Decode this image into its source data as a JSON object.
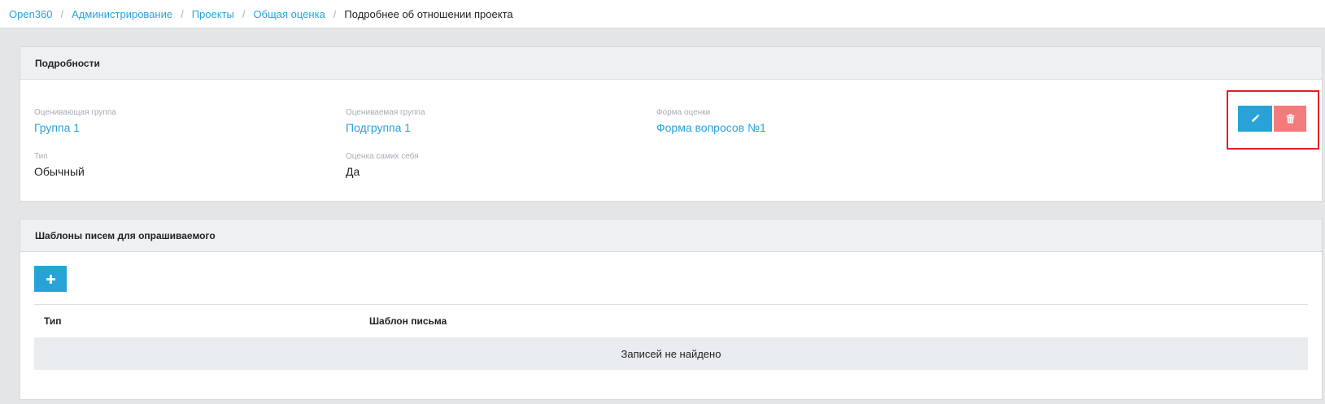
{
  "breadcrumb": {
    "items": [
      {
        "label": "Open360"
      },
      {
        "label": "Администрирование"
      },
      {
        "label": "Проекты"
      },
      {
        "label": "Общая оценка"
      }
    ],
    "separator": "/",
    "current": "Подробнее об отношении проекта"
  },
  "details": {
    "title": "Подробности",
    "fields": {
      "evaluating_group": {
        "label": "Оценивающая группа",
        "value": "Группа 1"
      },
      "evaluated_group": {
        "label": "Оцениваемая группа",
        "value": "Подгруппа 1"
      },
      "form": {
        "label": "Форма оценки",
        "value": "Форма вопросов №1"
      },
      "type": {
        "label": "Тип",
        "value": "Обычный"
      },
      "self_assessment": {
        "label": "Оценка самих себя",
        "value": "Да"
      }
    },
    "actions": {
      "edit_icon": "pencil-icon",
      "delete_icon": "trash-icon",
      "edit_color": "#27a3d8",
      "delete_color": "#f47b7b",
      "highlight_color": "#e41e26"
    }
  },
  "templates": {
    "title": "Шаблоны писем для опрашиваемого",
    "add_icon": "plus-icon",
    "columns": [
      "Тип",
      "Шаблон письма"
    ],
    "empty_text": "Записей не найдено"
  },
  "colors": {
    "accent": "#27a3d8",
    "danger": "#f47b7b",
    "background": "#e3e5e7"
  }
}
